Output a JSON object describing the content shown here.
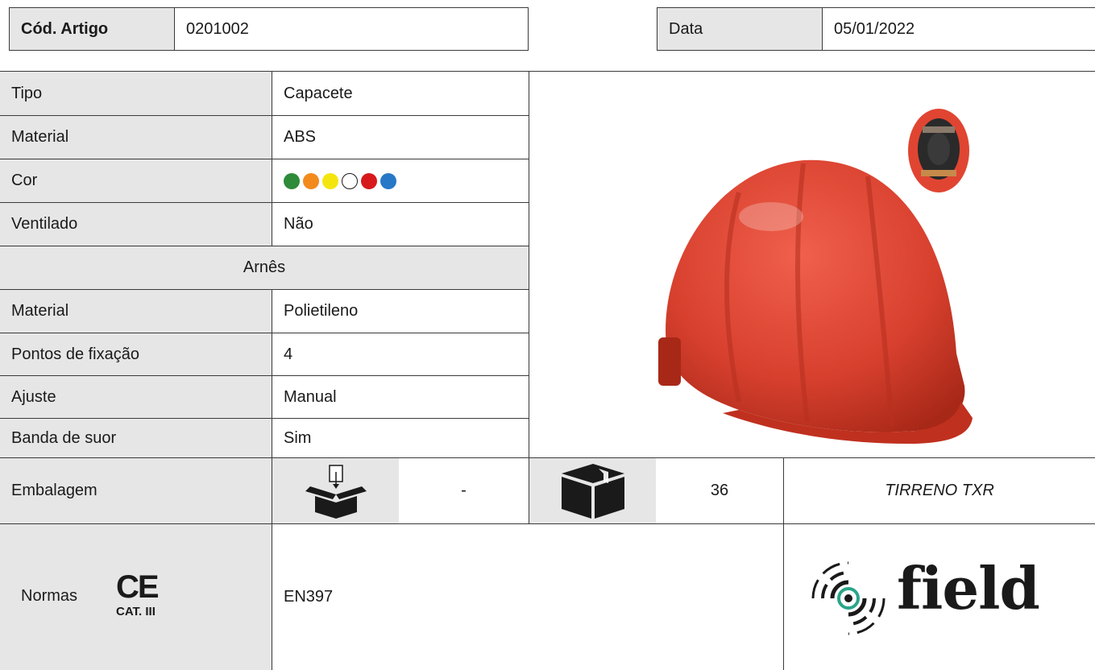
{
  "header": {
    "code_label": "Cód. Artigo",
    "code_value": "0201002",
    "date_label": "Data",
    "date_value": "05/01/2022"
  },
  "specs": {
    "rows": [
      {
        "label": "Tipo",
        "value": "Capacete"
      },
      {
        "label": "Material",
        "value": "ABS"
      },
      {
        "label": "Cor",
        "value": ""
      },
      {
        "label": "Ventilado",
        "value": "Não"
      }
    ],
    "section_title": "Arnês",
    "harness_rows": [
      {
        "label": "Material",
        "value": "Polietileno"
      },
      {
        "label": "Pontos de fixação",
        "value": "4"
      },
      {
        "label": "Ajuste",
        "value": "Manual"
      },
      {
        "label": "Banda de suor",
        "value": "Sim"
      }
    ],
    "colors": [
      "#2e8b3a",
      "#f28a1c",
      "#f5e50f",
      "#ffffff",
      "#d7191c",
      "#2878c8"
    ]
  },
  "packaging": {
    "label": "Embalagem",
    "inner_icon": "box-with-unit-icon",
    "inner_value": "-",
    "outer_icon": "closed-box-icon",
    "outer_value": "36",
    "model_name": "TIRRENO TXR"
  },
  "standards": {
    "label": "Normas",
    "ce_mark": "CE",
    "category": "CAT. III",
    "value": "EN397"
  },
  "brand": {
    "name": "field",
    "icon": "field-logo-icon"
  },
  "product_image": {
    "icon": "red-helmet-image"
  }
}
